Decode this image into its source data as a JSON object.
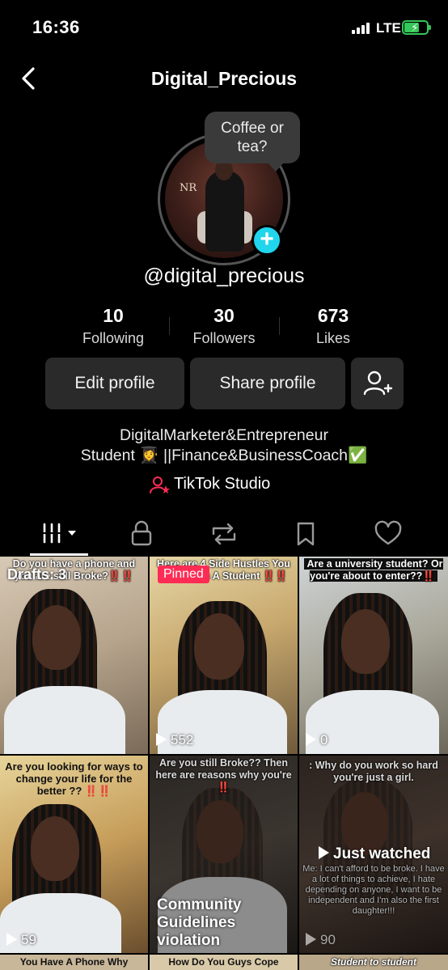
{
  "status": {
    "time": "16:36",
    "network": "LTE"
  },
  "header": {
    "title": "Digital_Precious"
  },
  "profile": {
    "bubble_text": "Coffee or tea?",
    "username": "@digital_precious",
    "stats": [
      {
        "num": "10",
        "label": "Following"
      },
      {
        "num": "30",
        "label": "Followers"
      },
      {
        "num": "673",
        "label": "Likes"
      }
    ],
    "edit_label": "Edit profile",
    "share_label": "Share profile",
    "bio_line1": "DigitalMarketer&Entrepreneur",
    "bio_line2": "Student 👩‍🎓 ||Finance&BusinessCoach✅",
    "studio_label": "TikTok Studio",
    "avatar_logo": "NR"
  },
  "tabs": [
    "videos-tab",
    "private-tab",
    "reposts-tab",
    "favorites-tab",
    "liked-tab"
  ],
  "grid": {
    "drafts_label": "Drafts: 3",
    "pinned_label": "Pinned",
    "cells": [
      {
        "caption": "Do you have a phone and you are still Broke?‼️‼️",
        "views": ""
      },
      {
        "caption": "Here are 4 Side Hustles You Can Do As A Student ‼️‼️",
        "views": "552"
      },
      {
        "caption": "Are a university student? Or you're about to enter??‼️",
        "views": "0"
      },
      {
        "caption": "Are you looking for ways to change your life for the better ?? ‼️‼️",
        "views": "59"
      },
      {
        "caption": "Are you still Broke?? Then here are reasons why you're ‼️",
        "views": "",
        "overlay": "Community Guidelines violation"
      },
      {
        "caption": ": Why do you work so hard you're just a girl.",
        "views": "90",
        "overlay": "Just watched",
        "sub": "Me: I can't afford to be broke. I have a lot of things to achieve, I hate depending on anyone, I want to be independent and I'm also the first daughter!!!"
      },
      {
        "caption": "You Have A Phone Why",
        "views": ""
      },
      {
        "caption": "How Do You Guys Cope",
        "views": ""
      },
      {
        "caption": "Student to student",
        "views": ""
      }
    ]
  }
}
